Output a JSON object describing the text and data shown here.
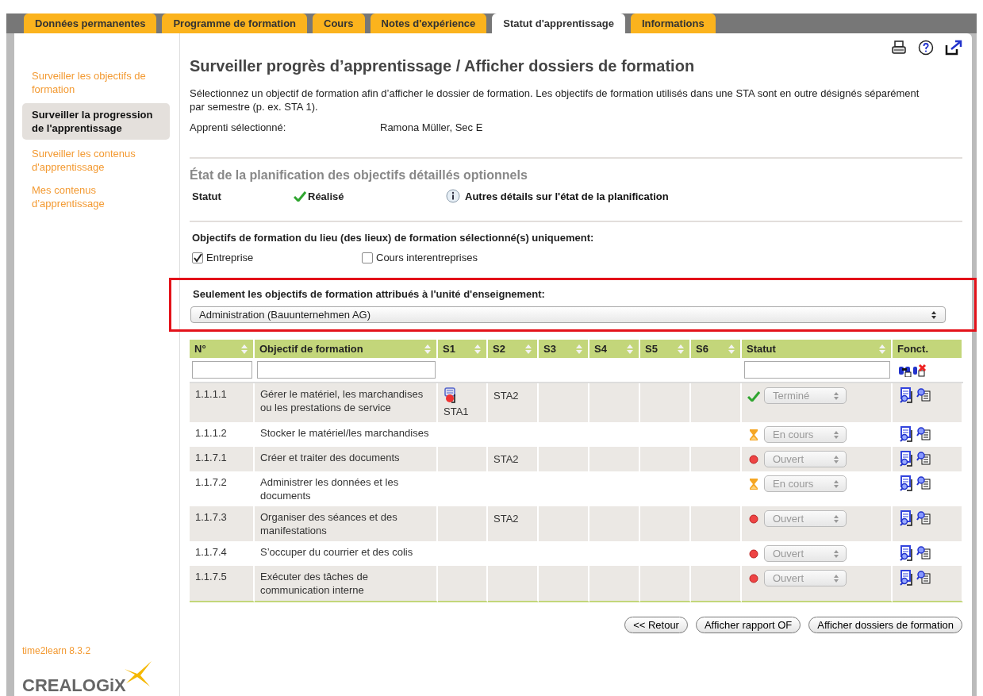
{
  "tabs": [
    {
      "label": "Données permanentes",
      "selected": false
    },
    {
      "label": "Programme de formation",
      "selected": false
    },
    {
      "label": "Cours",
      "selected": false
    },
    {
      "label": "Notes d'expérience",
      "selected": false
    },
    {
      "label": "Statut d'apprentissage",
      "selected": true
    },
    {
      "label": "Informations",
      "selected": false
    }
  ],
  "sidebar": {
    "items": [
      {
        "label": "Surveiller les objectifs de formation",
        "selected": false
      },
      {
        "label": "Surveiller la progression de l'apprentissage",
        "selected": true
      },
      {
        "label": "Surveiller les contenus d'apprentissage",
        "selected": false
      },
      {
        "label": "Mes contenus d’apprentissage",
        "selected": false
      }
    ],
    "version": "time2learn 8.3.2",
    "logo": "CREALOGiX"
  },
  "page": {
    "title": "Surveiller progrès d’apprentissage / Afficher dossiers de formation",
    "intro": "Sélectionnez un objectif de formation afin d’afficher le dossier de formation. Les objectifs de formation utilisés dans une STA sont en outre désignés séparément par semestre (p. ex. STA 1).",
    "apprentice_label": "Apprenti sélectionné:",
    "apprentice": "Ramona Müller, Sec E"
  },
  "planning": {
    "heading": "État de la planification des objectifs détaillés optionnels",
    "status_label": "Statut",
    "status": "Réalisé",
    "details_link": "Autres détails sur l'état de la planification"
  },
  "places": {
    "heading": "Objectifs de formation du lieu (des lieux) de formation sélectionné(s) uniquement:",
    "options": [
      {
        "label": "Entreprise",
        "checked": true
      },
      {
        "label": "Cours interentreprises",
        "checked": false
      }
    ]
  },
  "unit": {
    "highlighted": true,
    "heading": "Seulement les objectifs de formation attribués à l'unité d'enseignement:",
    "value": "Administration (Bauunternehmen AG)"
  },
  "table": {
    "columns": [
      {
        "label": "N°",
        "sortable": true,
        "filter": true
      },
      {
        "label": "Objectif de formation",
        "sortable": true,
        "filter": true
      },
      {
        "label": "S1",
        "sortable": true,
        "filter": false
      },
      {
        "label": "S2",
        "sortable": true,
        "filter": false
      },
      {
        "label": "S3",
        "sortable": true,
        "filter": false
      },
      {
        "label": "S4",
        "sortable": true,
        "filter": false
      },
      {
        "label": "S5",
        "sortable": true,
        "filter": false
      },
      {
        "label": "S6",
        "sortable": true,
        "filter": false
      },
      {
        "label": "Statut",
        "sortable": true,
        "filter": true
      },
      {
        "label": "Fonct.",
        "sortable": false,
        "filter": false
      }
    ],
    "rows": [
      {
        "no": "1.1.1.1",
        "goal": "Gérer le matériel, les marchandises ou les prestations de service",
        "s1": "STA1",
        "s2": "STA2",
        "s1_icon": true,
        "kind": "done",
        "status": "Terminé"
      },
      {
        "no": "1.1.1.2",
        "goal": "Stocker le matériel/les marchandises",
        "s1_icon": false,
        "kind": "progress",
        "status": "En cours"
      },
      {
        "no": "1.1.7.1",
        "goal": "Créer et traiter des documents",
        "s2": "STA2",
        "s1_icon": false,
        "kind": "open",
        "status": "Ouvert"
      },
      {
        "no": "1.1.7.2",
        "goal": "Administrer les données et les documents",
        "s1_icon": false,
        "kind": "progress",
        "status": "En cours"
      },
      {
        "no": "1.1.7.3",
        "goal": "Organiser des séances et des manifestations",
        "s2": "STA2",
        "s1_icon": false,
        "kind": "open",
        "status": "Ouvert"
      },
      {
        "no": "1.1.7.4",
        "goal": "S’occuper du courrier et des colis",
        "s1_icon": false,
        "kind": "open",
        "status": "Ouvert"
      },
      {
        "no": "1.1.7.5",
        "goal": "Exécuter des tâches de communication interne",
        "s1_icon": false,
        "kind": "open",
        "status": "Ouvert"
      }
    ]
  },
  "buttons": [
    "<< Retour",
    "Afficher rapport OF",
    "Afficher dossiers de formation"
  ]
}
